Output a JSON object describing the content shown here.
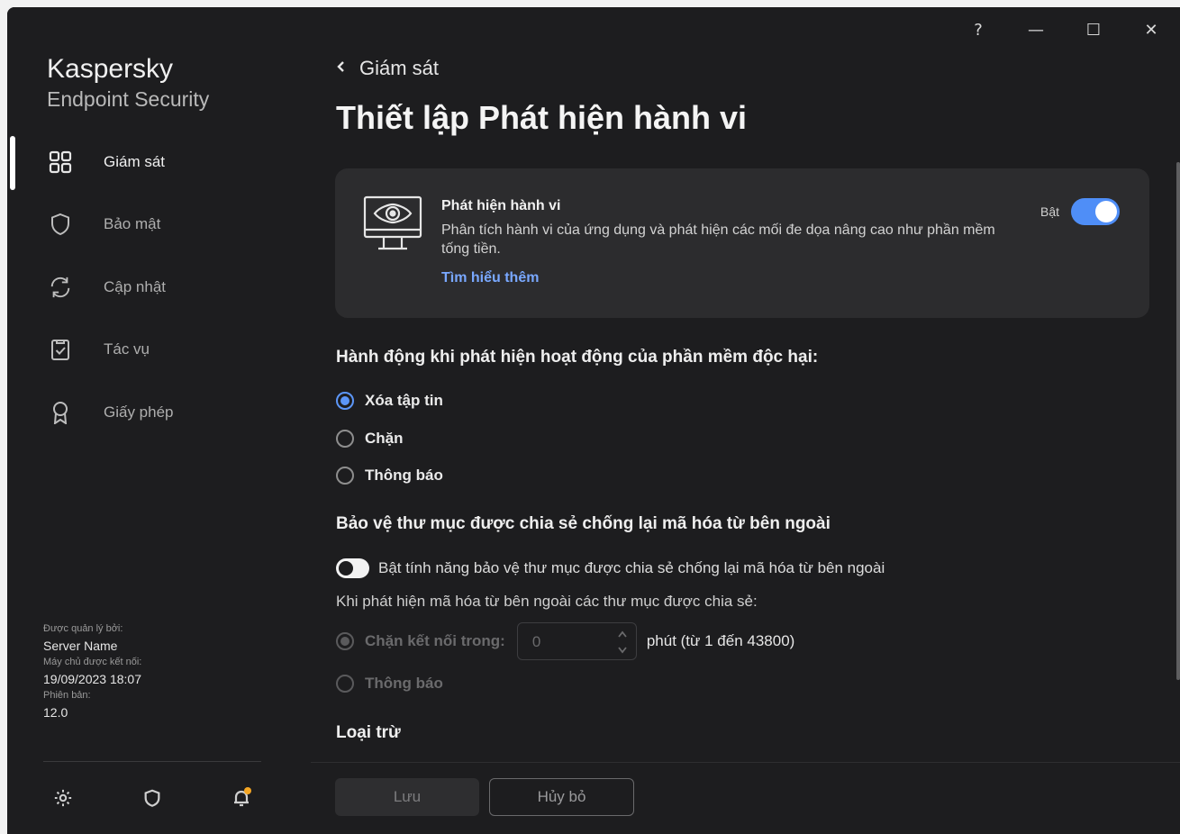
{
  "window": {
    "help": "?",
    "minimize": "—",
    "maximize": "☐",
    "close": "✕"
  },
  "app": {
    "name": "Kaspersky",
    "product": "Endpoint Security"
  },
  "sidebar": {
    "items": [
      {
        "label": "Giám sát",
        "icon": "dashboard-icon",
        "active": true
      },
      {
        "label": "Bảo mật",
        "icon": "shield-icon",
        "active": false
      },
      {
        "label": "Cập nhật",
        "icon": "refresh-icon",
        "active": false
      },
      {
        "label": "Tác vụ",
        "icon": "clipboard-check-icon",
        "active": false
      },
      {
        "label": "Giấy phép",
        "icon": "award-icon",
        "active": false
      }
    ],
    "managed_by_label": "Được quản lý bởi:",
    "managed_by_value": "Server Name",
    "connected_label": "Máy chủ được kết nối:",
    "connected_value": "19/09/2023 18:07",
    "version_label": "Phiên bản:",
    "version_value": "12.0",
    "bottom_icons": [
      "gear-icon",
      "kaspersky-shield-icon",
      "bell-icon"
    ],
    "notification_dot_color": "#f5a623"
  },
  "main": {
    "breadcrumb": "Giám sát",
    "title": "Thiết lập Phát hiện hành vi",
    "card": {
      "title": "Phát hiện hành vi",
      "description": "Phân tích hành vi của ứng dụng và phát hiện các mối đe dọa nâng cao như phần mềm tống tiền.",
      "link": "Tìm hiểu thêm",
      "toggle_label": "Bật",
      "toggle_on": true
    },
    "action_section": {
      "heading": "Hành động khi phát hiện hoạt động của phần mềm độc hại:",
      "options": [
        "Xóa tập tin",
        "Chặn",
        "Thông báo"
      ],
      "selected": "Xóa tập tin"
    },
    "shared_section": {
      "heading": "Bảo vệ thư mục được chia sẻ chống lại mã hóa từ bên ngoài",
      "switch_label": "Bật tính năng bảo vệ thư mục được chia sẻ chống lại mã hóa từ bên ngoài",
      "switch_on": false,
      "sub_label": "Khi phát hiện mã hóa từ bên ngoài các thư mục được chia sẻ:",
      "block_label": "Chặn kết nối trong:",
      "block_value": "0",
      "block_unit": "phút (từ 1 đến 43800)",
      "notify_label": "Thông báo"
    },
    "exclusions_heading": "Loại trừ",
    "save_label": "Lưu",
    "cancel_label": "Hủy bỏ"
  },
  "colors": {
    "accent": "#4f8ef7",
    "link": "#79a8ff",
    "background": "#1d1d1f",
    "card": "#2c2c2e"
  }
}
